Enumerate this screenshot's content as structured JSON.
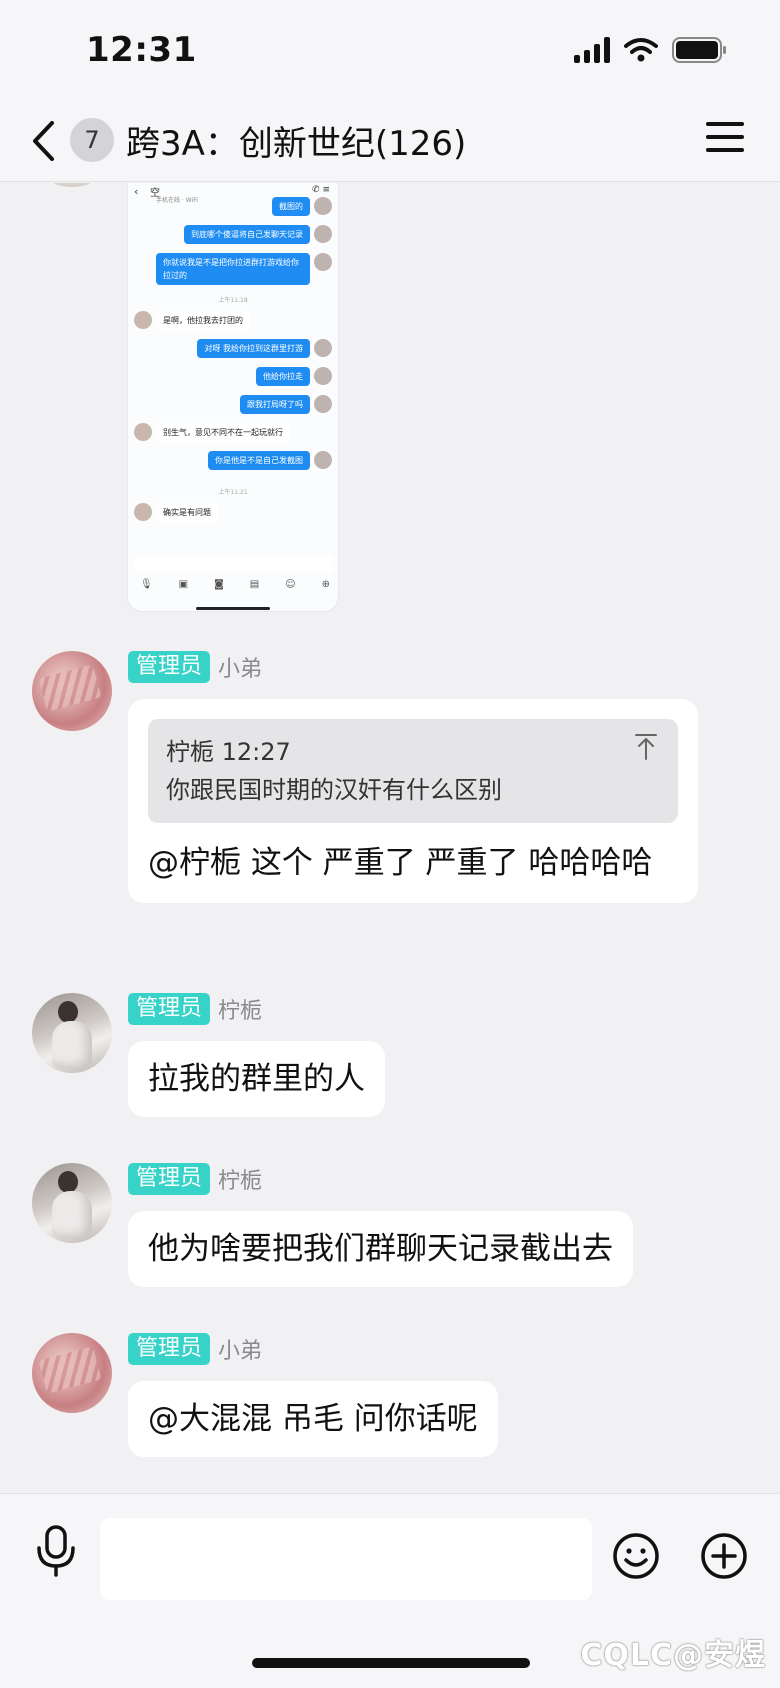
{
  "status_bar": {
    "time": "12:31"
  },
  "header": {
    "unread_count": "7",
    "title": "跨3A：创新世纪(126)"
  },
  "screenshot_message": {
    "title": "空",
    "subtitle": "手机在线 · WiFi",
    "messages": [
      {
        "side": "out",
        "text": "截图的"
      },
      {
        "side": "out",
        "text": "到底哪个傻逼将自己发聊天记录"
      },
      {
        "side": "out",
        "text": "你就说我是不是把你拉进群打游戏给你拉过的"
      },
      {
        "side": "time",
        "text": "上午11:18"
      },
      {
        "side": "in",
        "text": "是啊，他拉我去打团的"
      },
      {
        "side": "out",
        "text": "对呀 我给你拉到这群里打游"
      },
      {
        "side": "out",
        "text": "他给你拉走"
      },
      {
        "side": "out",
        "text": "跟我打局呀了吗"
      },
      {
        "side": "in",
        "text": "别生气，意见不同不在一起玩就行"
      },
      {
        "side": "out",
        "text": "你是他是不是自己发截图"
      },
      {
        "side": "time",
        "text": "上午11:21"
      },
      {
        "side": "in",
        "text": "确实是有问题"
      }
    ]
  },
  "messages": [
    {
      "role": "管理员",
      "sender": "小弟",
      "quote_author_time": "柠栀 12:27",
      "quote_text": "你跟民国时期的汉奸有什么区别",
      "text": "@柠栀 这个 严重了 严重了  哈哈哈哈"
    },
    {
      "role": "管理员",
      "sender": "柠栀",
      "text": "拉我的群里的人"
    },
    {
      "role": "管理员",
      "sender": "柠栀",
      "text": "他为啥要把我们群聊天记录截出去"
    },
    {
      "role": "管理员",
      "sender": "小弟",
      "text": "@大混混 吊毛 问你话呢"
    }
  ],
  "input": {
    "placeholder": ""
  },
  "watermark": "CQLC@安煜",
  "colors": {
    "role_badge": "#38d3c8",
    "screenshot_bubble": "#1e8cf2",
    "background": "#f1f1f3"
  }
}
